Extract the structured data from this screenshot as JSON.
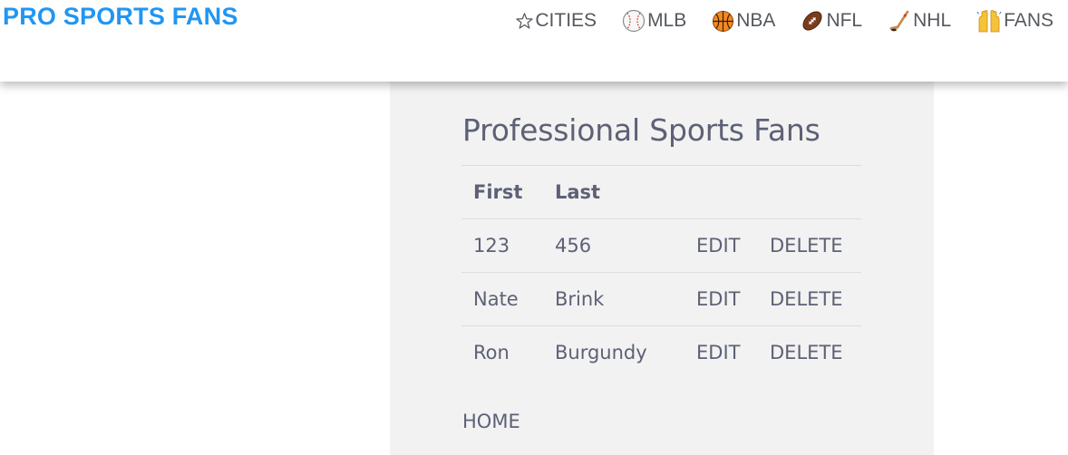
{
  "header": {
    "brand": "PRO SPORTS FANS",
    "brand_color": "#2196f3",
    "nav": [
      {
        "label": "CITIES",
        "icon": "star-icon"
      },
      {
        "label": "MLB",
        "icon": "baseball-icon"
      },
      {
        "label": "NBA",
        "icon": "basketball-icon"
      },
      {
        "label": "NFL",
        "icon": "football-icon"
      },
      {
        "label": "NHL",
        "icon": "hockey-stick-icon"
      },
      {
        "label": "FANS",
        "icon": "raised-hands-icon"
      }
    ]
  },
  "main": {
    "title": "Professional Sports Fans",
    "table": {
      "columns": [
        "First",
        "Last",
        "",
        ""
      ],
      "rows": [
        {
          "first": "123",
          "last": "456",
          "edit": "EDIT",
          "delete": "DELETE"
        },
        {
          "first": "Nate",
          "last": "Brink",
          "edit": "EDIT",
          "delete": "DELETE"
        },
        {
          "first": "Ron",
          "last": "Burgundy",
          "edit": "EDIT",
          "delete": "DELETE"
        }
      ]
    },
    "home_link": "HOME"
  }
}
